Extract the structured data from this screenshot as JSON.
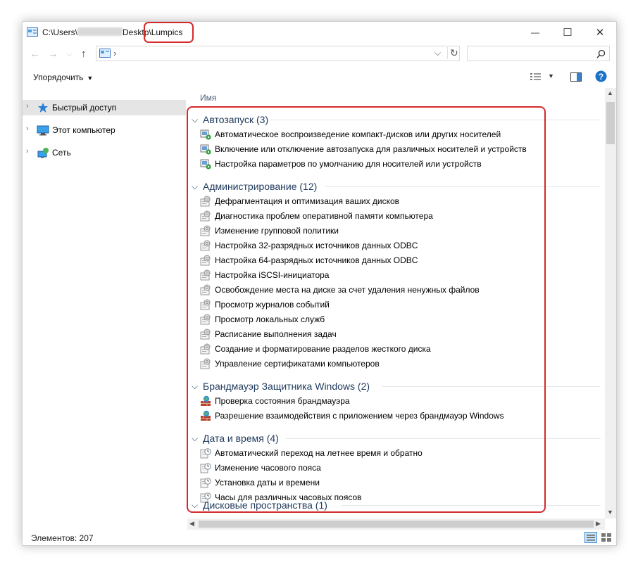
{
  "window": {
    "title_prefix": "C:\\Users\\",
    "title_middle": "Deskt",
    "title_highlighted": "p\\Lumpics",
    "minimize": "—",
    "maximize": "☐",
    "close": "✕"
  },
  "address_bar": {
    "path_separator": "›",
    "dropdown": "⌵",
    "refresh": "↻",
    "search_placeholder": ""
  },
  "toolbar": {
    "sort_label": "Упорядочить"
  },
  "navigation": {
    "items": [
      {
        "label": "Быстрый доступ",
        "icon": "star-icon",
        "selected": true
      },
      {
        "label": "Этот компьютер",
        "icon": "computer-icon",
        "selected": false
      },
      {
        "label": "Сеть",
        "icon": "network-icon",
        "selected": false
      }
    ]
  },
  "file_list": {
    "column_name": "Имя",
    "groups": [
      {
        "title": "Автозапуск (3)",
        "icon": "autoplay-icon",
        "items": [
          "Автоматическое воспроизведение компакт-дисков или других носителей",
          "Включение или отключение автозапуска для различных носителей и устройств",
          "Настройка параметров по умолчанию для носителей или устройств"
        ]
      },
      {
        "title": "Администрирование (12)",
        "icon": "admin-tools-icon",
        "items": [
          "Дефрагментация и оптимизация ваших дисков",
          "Диагностика проблем оперативной памяти компьютера",
          "Изменение групповой политики",
          "Настройка 32-разрядных источников данных ODBC",
          "Настройка 64-разрядных источников данных ODBC",
          "Настройка iSCSI-инициатора",
          "Освобождение места на диске за счет удаления ненужных файлов",
          "Просмотр журналов событий",
          "Просмотр локальных служб",
          "Расписание выполнения задач",
          "Создание и форматирование разделов жесткого диска",
          "Управление сертификатами компьютеров"
        ]
      },
      {
        "title": "Брандмауэр Защитника Windows (2)",
        "icon": "firewall-icon",
        "items": [
          "Проверка состояния брандмауэра",
          "Разрешение взаимодействия с приложением через брандмауэр Windows"
        ]
      },
      {
        "title": "Дата и время (4)",
        "icon": "clock-icon",
        "items": [
          "Автоматический переход на летнее время и обратно",
          "Изменение часового пояса",
          "Установка даты и времени",
          "Часы для различных часовых поясов"
        ]
      },
      {
        "title": "Дисковые пространства (1)",
        "icon": "storage-icon",
        "items": []
      }
    ]
  },
  "status": {
    "items_count": "Элементов: 207"
  },
  "colors": {
    "highlight": "#d32a2a",
    "group_title": "#1e395b",
    "selected_nav": "#e5e5e5"
  }
}
